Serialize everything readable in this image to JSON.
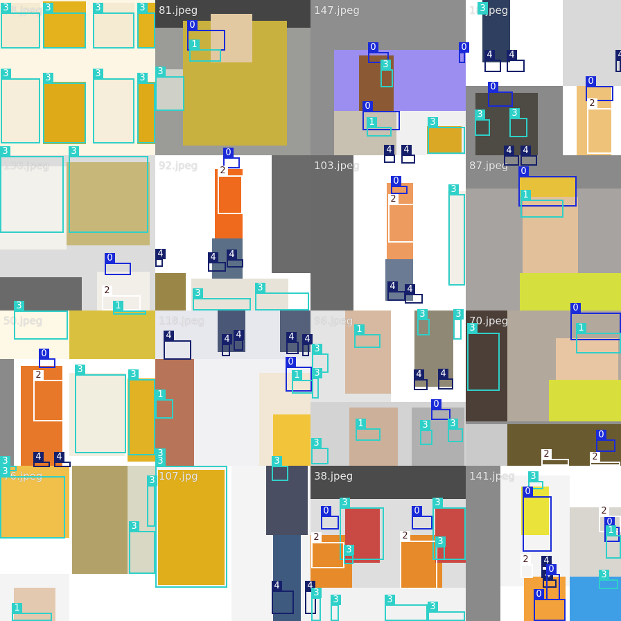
{
  "tiles": [
    {
      "title": "58.jpeg"
    },
    {
      "title": "81.jpeg"
    },
    {
      "title": "147.jpeg"
    },
    {
      "title": "18.jpeg"
    },
    {
      "title": "136.jpeg"
    },
    {
      "title": "92.jpeg"
    },
    {
      "title": "103.jpeg"
    },
    {
      "title": "87.jpeg"
    },
    {
      "title": "50.jpeg"
    },
    {
      "title": "118.jpeg"
    },
    {
      "title": "96.jpeg"
    },
    {
      "title": "70.jpeg"
    },
    {
      "title": "76.jpeg"
    },
    {
      "title": "107.jpg"
    },
    {
      "title": "38.jpeg"
    },
    {
      "title": "141.jpeg"
    }
  ],
  "class_colors": {
    "0": "#1a2ad8",
    "1": "#2fd0c8",
    "2": "#ffffff",
    "3": "#2fd0c8",
    "4": "#16206a"
  },
  "boxes": [
    {
      "tile": 0,
      "label": "3"
    },
    {
      "tile": 0,
      "label": "3"
    },
    {
      "tile": 0,
      "label": "3"
    },
    {
      "tile": 0,
      "label": "3"
    },
    {
      "tile": 0,
      "label": "3"
    },
    {
      "tile": 0,
      "label": "3"
    },
    {
      "tile": 0,
      "label": "3"
    },
    {
      "tile": 0,
      "label": "3"
    },
    {
      "tile": 1,
      "label": "0"
    },
    {
      "tile": 1,
      "label": "1"
    },
    {
      "tile": 1,
      "label": "3"
    },
    {
      "tile": 2,
      "label": "0"
    },
    {
      "tile": 2,
      "label": "0"
    },
    {
      "tile": 2,
      "label": "3"
    },
    {
      "tile": 2,
      "label": "0"
    },
    {
      "tile": 2,
      "label": "1"
    },
    {
      "tile": 2,
      "label": "3"
    },
    {
      "tile": 2,
      "label": "4"
    },
    {
      "tile": 2,
      "label": "4"
    },
    {
      "tile": 3,
      "label": "3"
    },
    {
      "tile": 3,
      "label": "4"
    },
    {
      "tile": 3,
      "label": "4"
    },
    {
      "tile": 3,
      "label": "4"
    },
    {
      "tile": 3,
      "label": "0"
    },
    {
      "tile": 3,
      "label": "3"
    },
    {
      "tile": 3,
      "label": "3"
    },
    {
      "tile": 3,
      "label": "0"
    },
    {
      "tile": 3,
      "label": "2"
    },
    {
      "tile": 3,
      "label": "4"
    },
    {
      "tile": 3,
      "label": "4"
    },
    {
      "tile": 4,
      "label": "3"
    },
    {
      "tile": 4,
      "label": "3"
    },
    {
      "tile": 4,
      "label": "0"
    },
    {
      "tile": 4,
      "label": "2"
    },
    {
      "tile": 4,
      "label": "1"
    },
    {
      "tile": 5,
      "label": "0"
    },
    {
      "tile": 5,
      "label": "2"
    },
    {
      "tile": 5,
      "label": "4"
    },
    {
      "tile": 5,
      "label": "4"
    },
    {
      "tile": 5,
      "label": "4"
    },
    {
      "tile": 5,
      "label": "3"
    },
    {
      "tile": 5,
      "label": "3"
    },
    {
      "tile": 6,
      "label": "0"
    },
    {
      "tile": 6,
      "label": "2"
    },
    {
      "tile": 6,
      "label": "3"
    },
    {
      "tile": 6,
      "label": "4"
    },
    {
      "tile": 6,
      "label": "4"
    },
    {
      "tile": 7,
      "label": "0"
    },
    {
      "tile": 7,
      "label": "1"
    },
    {
      "tile": 8,
      "label": "3"
    },
    {
      "tile": 8,
      "label": "0"
    },
    {
      "tile": 8,
      "label": "2"
    },
    {
      "tile": 8,
      "label": "3"
    },
    {
      "tile": 8,
      "label": "3"
    },
    {
      "tile": 8,
      "label": "4"
    },
    {
      "tile": 8,
      "label": "4"
    },
    {
      "tile": 8,
      "label": "3"
    },
    {
      "tile": 9,
      "label": "4"
    },
    {
      "tile": 9,
      "label": "4"
    },
    {
      "tile": 9,
      "label": "4"
    },
    {
      "tile": 9,
      "label": "4"
    },
    {
      "tile": 9,
      "label": "4"
    },
    {
      "tile": 9,
      "label": "0"
    },
    {
      "tile": 9,
      "label": "1"
    },
    {
      "tile": 9,
      "label": "1"
    },
    {
      "tile": 9,
      "label": "3"
    },
    {
      "tile": 10,
      "label": "1"
    },
    {
      "tile": 10,
      "label": "3"
    },
    {
      "tile": 10,
      "label": "3"
    },
    {
      "tile": 10,
      "label": "3"
    },
    {
      "tile": 10,
      "label": "3"
    },
    {
      "tile": 10,
      "label": "4"
    },
    {
      "tile": 10,
      "label": "4"
    },
    {
      "tile": 10,
      "label": "0"
    },
    {
      "tile": 10,
      "label": "1"
    },
    {
      "tile": 10,
      "label": "3"
    },
    {
      "tile": 10,
      "label": "3"
    },
    {
      "tile": 10,
      "label": "3"
    },
    {
      "tile": 11,
      "label": "0"
    },
    {
      "tile": 11,
      "label": "1"
    },
    {
      "tile": 11,
      "label": "3"
    },
    {
      "tile": 11,
      "label": "0"
    },
    {
      "tile": 11,
      "label": "2"
    },
    {
      "tile": 11,
      "label": "2"
    },
    {
      "tile": 12,
      "label": "3"
    },
    {
      "tile": 12,
      "label": "3"
    },
    {
      "tile": 12,
      "label": "3"
    },
    {
      "tile": 12,
      "label": "1"
    },
    {
      "tile": 13,
      "label": "3"
    },
    {
      "tile": 13,
      "label": "3"
    },
    {
      "tile": 13,
      "label": "4"
    },
    {
      "tile": 13,
      "label": "4"
    },
    {
      "tile": 14,
      "label": "0"
    },
    {
      "tile": 14,
      "label": "3"
    },
    {
      "tile": 14,
      "label": "2"
    },
    {
      "tile": 14,
      "label": "3"
    },
    {
      "tile": 14,
      "label": "3"
    },
    {
      "tile": 14,
      "label": "0"
    },
    {
      "tile": 14,
      "label": "3"
    },
    {
      "tile": 14,
      "label": "2"
    },
    {
      "tile": 14,
      "label": "3"
    },
    {
      "tile": 14,
      "label": "3"
    },
    {
      "tile": 14,
      "label": "3"
    },
    {
      "tile": 14,
      "label": "3"
    },
    {
      "tile": 14,
      "label": "3"
    },
    {
      "tile": 15,
      "label": "0"
    },
    {
      "tile": 15,
      "label": "2"
    },
    {
      "tile": 15,
      "label": "4"
    },
    {
      "tile": 15,
      "label": "4"
    },
    {
      "tile": 15,
      "label": "0"
    },
    {
      "tile": 15,
      "label": "2"
    },
    {
      "tile": 15,
      "label": "0"
    },
    {
      "tile": 15,
      "label": "1"
    },
    {
      "tile": 15,
      "label": "3"
    },
    {
      "tile": 15,
      "label": "0"
    },
    {
      "tile": 15,
      "label": "2"
    }
  ]
}
